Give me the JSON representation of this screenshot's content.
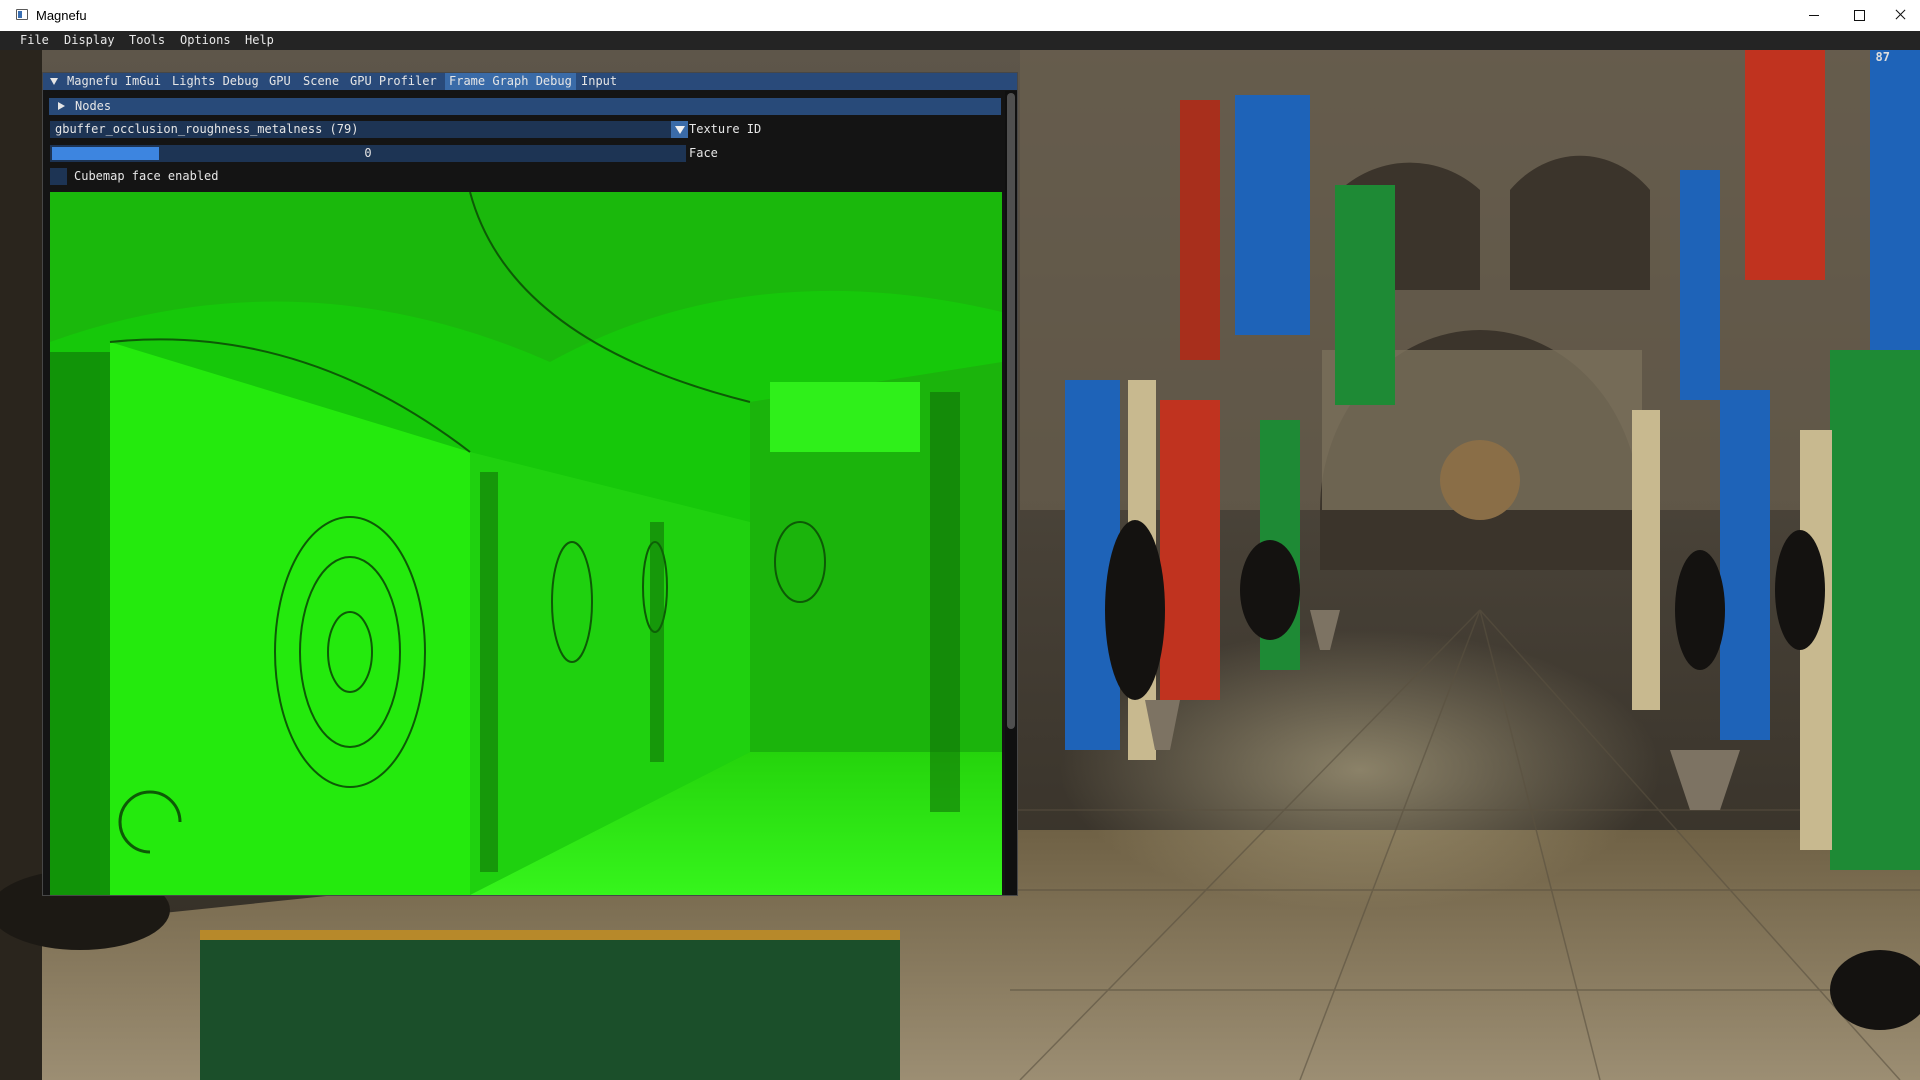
{
  "window": {
    "title": "Magnefu",
    "controls": {
      "minimize": "minimize",
      "maximize": "maximize",
      "close": "close"
    }
  },
  "menu": [
    "File",
    "Display",
    "Tools",
    "Options",
    "Help"
  ],
  "overlay": {
    "fps": "87"
  },
  "imgui": {
    "tabs": [
      "Magnefu ImGui",
      "Lights Debug",
      "GPU",
      "Scene",
      "GPU Profiler",
      "Frame Graph Debug",
      "Input"
    ],
    "active_tab": "Frame Graph Debug",
    "nodes_label": "Nodes",
    "texture_combo": {
      "value": "gbuffer_occlusion_roughness_metalness (79)",
      "label": "Texture ID"
    },
    "face_slider": {
      "value": "0",
      "label": "Face",
      "fill_fraction": 0.17
    },
    "cubemap_checkbox": {
      "label": "Cubemap face enabled",
      "checked": false
    },
    "texture_preview": {
      "tint": "#22ff00"
    }
  },
  "colors": {
    "imgui_menubar": "#294a7a",
    "imgui_accent": "#3a6ba8",
    "frame_bg": "#1d3454",
    "texture_green": "#00e000",
    "banner_blue": "#1e63b8",
    "banner_red": "#c0331f",
    "banner_green": "#1e8a35"
  },
  "icons": [
    "app-icon",
    "minimize-icon",
    "maximize-icon",
    "close-icon",
    "collapse-arrow-icon",
    "tree-arrow-icon",
    "combo-arrow-icon"
  ]
}
